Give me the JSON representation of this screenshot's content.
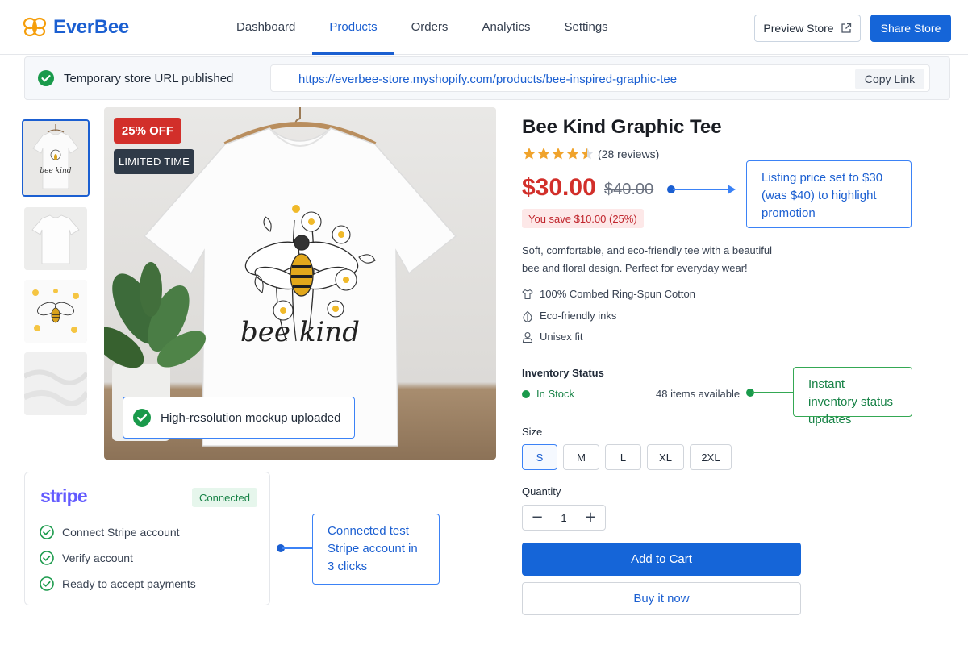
{
  "app": {
    "name": "EverBee",
    "logo_icon": "bee-icon"
  },
  "nav": {
    "items": [
      {
        "label": "Dashboard",
        "active": false
      },
      {
        "label": "Products",
        "active": true
      },
      {
        "label": "Orders",
        "active": false
      },
      {
        "label": "Analytics",
        "active": false
      },
      {
        "label": "Settings",
        "active": false
      }
    ],
    "preview_label": "Preview Store",
    "preview_icon": "external-link-icon",
    "share_label": "Share Store"
  },
  "url_bar": {
    "status": "Temporary store URL published",
    "url": "https://everbee-store.myshopify.com/products/bee-inspired-graphic-tee",
    "copy_label": "Copy Link"
  },
  "gallery": {
    "thumbnails": [
      "tee-with-design-on-hanger",
      "plain-white-tee",
      "bee-design-artwork",
      "fabric-closeup"
    ],
    "selected_index": 0,
    "discount_badge": "25% OFF",
    "limited_badge": "LIMITED TIME",
    "upload_status": "High-resolution mockup uploaded",
    "shirt_text": "bee kind"
  },
  "stripe": {
    "logo": "stripe",
    "status": "Connected",
    "steps": [
      "Connect Stripe account",
      "Verify account",
      "Ready to accept payments"
    ]
  },
  "callouts": {
    "stripe": "Connected test Stripe account in 3 clicks",
    "price": "Listing price set to $30 (was $40) to highlight promotion",
    "inventory": "Instant inventory status updates"
  },
  "product": {
    "title": "Bee Kind Graphic Tee",
    "rating": 4.5,
    "reviews": "(28 reviews)",
    "price": "$30.00",
    "original_price": "$40.00",
    "savings": "You save $10.00 (25%)",
    "description": "Soft, comfortable, and eco-friendly tee with a beautiful bee and floral design. Perfect for everyday wear!",
    "features": [
      {
        "icon": "shirt-icon",
        "label": "100% Combed Ring-Spun Cotton"
      },
      {
        "icon": "leaf-icon",
        "label": "Eco-friendly inks"
      },
      {
        "icon": "user-icon",
        "label": "Unisex fit"
      }
    ],
    "inventory_label": "Inventory Status",
    "stock_status": "In Stock",
    "available": "48 items available",
    "size_label": "Size",
    "sizes": [
      "S",
      "M",
      "L",
      "XL",
      "2XL"
    ],
    "selected_size": "S",
    "quantity_label": "Quantity",
    "quantity": "1",
    "add_to_cart": "Add to Cart",
    "buy_now": "Buy it now"
  },
  "colors": {
    "brand": "#1b5fd1",
    "primary_button": "#1565d8",
    "sale_red": "#d22f2a",
    "success_green": "#178246",
    "stripe_purple": "#635bff"
  }
}
